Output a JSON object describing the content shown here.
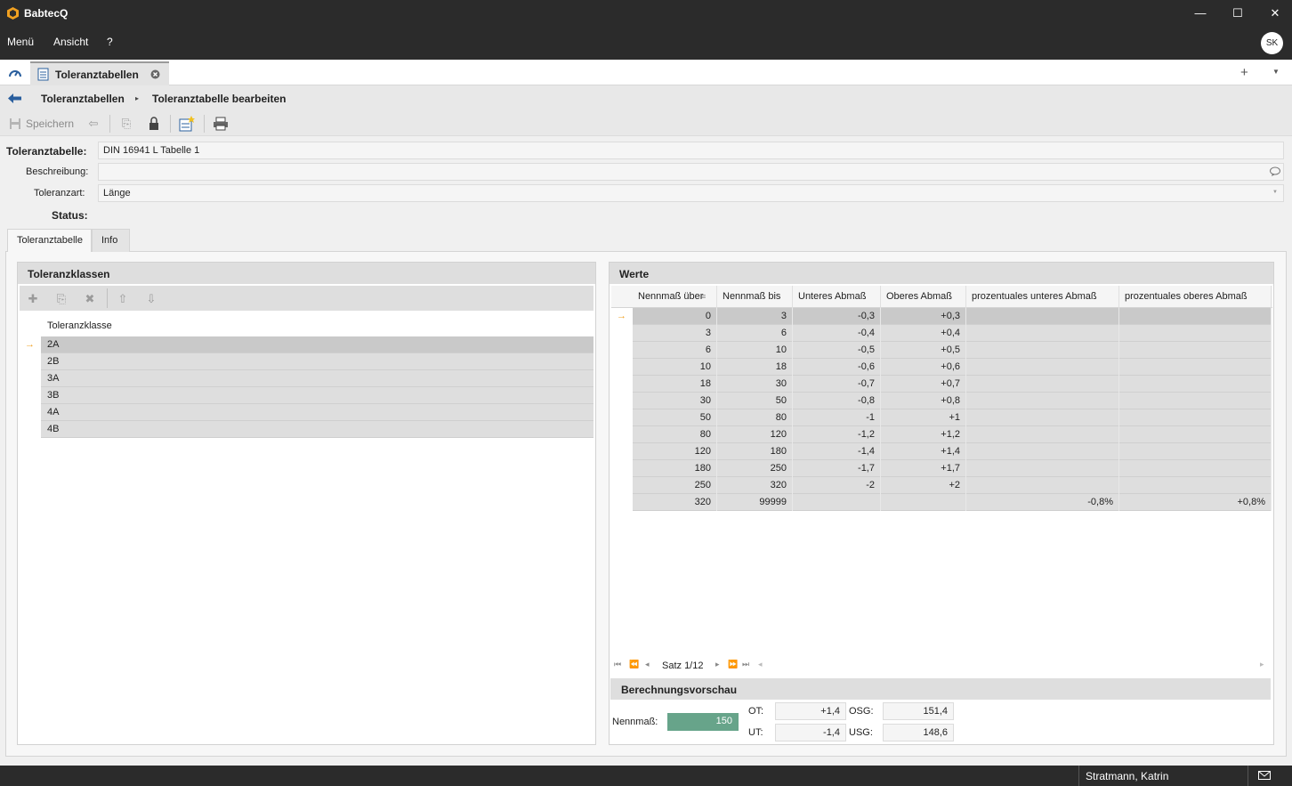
{
  "app": {
    "title": "BabtecQ"
  },
  "menu": {
    "items": [
      "Menü",
      "Ansicht",
      "?"
    ],
    "user_initials": "SK"
  },
  "window": {
    "min_symbol": "—",
    "max_symbol": "☐",
    "close_symbol": "✕"
  },
  "tabs": {
    "active": "Toleranztabellen"
  },
  "breadcrumb": {
    "root": "Toleranztabellen",
    "current": "Toleranztabelle bearbeiten"
  },
  "toolbar": {
    "save_label": "Speichern"
  },
  "form": {
    "toleranztabelle_label": "Toleranztabelle:",
    "toleranztabelle_value": "DIN 16941 L Tabelle 1",
    "beschreibung_label": "Beschreibung:",
    "beschreibung_value": "",
    "toleranzart_label": "Toleranzart:",
    "toleranzart_value": "Länge",
    "status_label": "Status:"
  },
  "subtabs": {
    "tab1": "Toleranztabelle",
    "tab2": "Info"
  },
  "toleranzklassen": {
    "title": "Toleranzklassen",
    "column": "Toleranzklasse",
    "rows": [
      "2A",
      "2B",
      "3A",
      "3B",
      "4A",
      "4B"
    ]
  },
  "werte": {
    "title": "Werte",
    "columns": [
      "Nennmaß über",
      "Nennmaß bis",
      "Unteres Abmaß",
      "Oberes Abmaß",
      "prozentuales unteres Abmaß",
      "prozentuales oberes Abmaß"
    ],
    "rows": [
      [
        "0",
        "3",
        "-0,3",
        "+0,3",
        "",
        ""
      ],
      [
        "3",
        "6",
        "-0,4",
        "+0,4",
        "",
        ""
      ],
      [
        "6",
        "10",
        "-0,5",
        "+0,5",
        "",
        ""
      ],
      [
        "10",
        "18",
        "-0,6",
        "+0,6",
        "",
        ""
      ],
      [
        "18",
        "30",
        "-0,7",
        "+0,7",
        "",
        ""
      ],
      [
        "30",
        "50",
        "-0,8",
        "+0,8",
        "",
        ""
      ],
      [
        "50",
        "80",
        "-1",
        "+1",
        "",
        ""
      ],
      [
        "80",
        "120",
        "-1,2",
        "+1,2",
        "",
        ""
      ],
      [
        "120",
        "180",
        "-1,4",
        "+1,4",
        "",
        ""
      ],
      [
        "180",
        "250",
        "-1,7",
        "+1,7",
        "",
        ""
      ],
      [
        "250",
        "320",
        "-2",
        "+2",
        "",
        ""
      ],
      [
        "320",
        "99999",
        "",
        "",
        "-0,8%",
        "+0,8%"
      ]
    ],
    "record": "Satz 1/12"
  },
  "berechnung": {
    "title": "Berechnungsvorschau",
    "nennmass_label": "Nennmaß:",
    "nennmass_value": "150",
    "ot_label": "OT:",
    "ot_value": "+1,4",
    "ut_label": "UT:",
    "ut_value": "-1,4",
    "osg_label": "OSG:",
    "osg_value": "151,4",
    "usg_label": "USG:",
    "usg_value": "148,6"
  },
  "status": {
    "user": "Stratmann, Katrin"
  },
  "colors": {
    "accent": "#f0a020",
    "nennmass_bg": "#67a48a",
    "titlebar": "#2b2b2b"
  }
}
